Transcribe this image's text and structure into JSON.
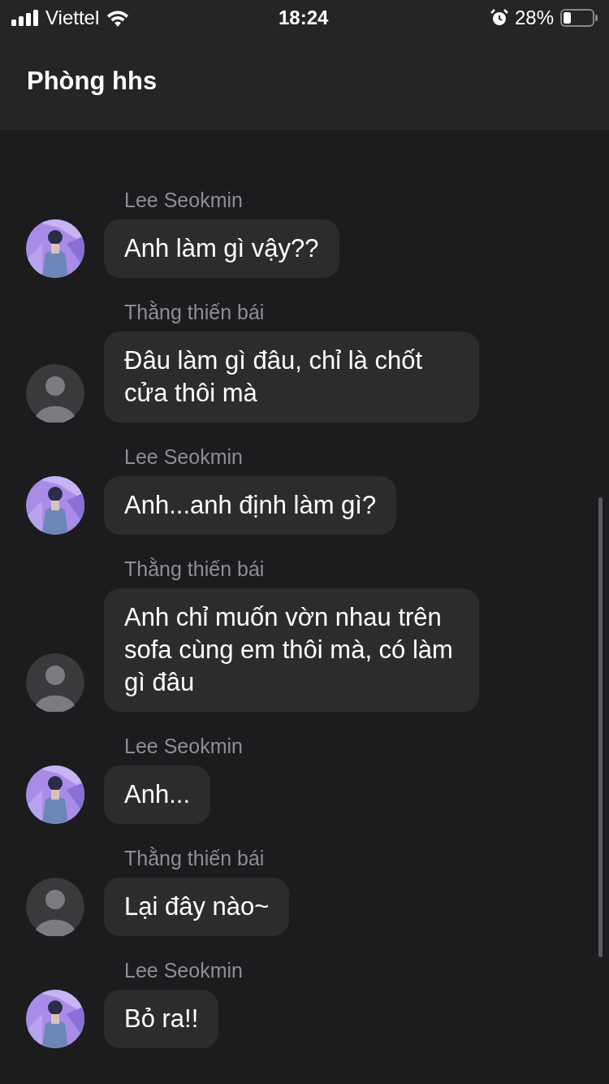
{
  "status_bar": {
    "carrier": "Viettel",
    "time": "18:24",
    "battery": "28%"
  },
  "header": {
    "title": "Phòng hhs"
  },
  "messages": [
    {
      "sender": "Lee Seokmin",
      "text": "Anh làm gì vậy??"
    },
    {
      "sender": "Thằng thiến bái",
      "kind": "default",
      "text": "Đâu làm gì đâu, chỉ là chốt cửa thôi mà"
    },
    {
      "sender": "Lee Seokmin",
      "text": "Anh...anh định làm gì?"
    },
    {
      "sender": "Thằng thiến bái",
      "kind": "default",
      "text": "Anh chỉ muốn vờn nhau trên sofa cùng em thôi mà, có làm gì đâu"
    },
    {
      "sender": "Lee Seokmin",
      "text": "Anh..."
    },
    {
      "sender": "Thằng thiến bái",
      "kind": "default",
      "text": "Lại đây nào~"
    },
    {
      "sender": "Lee Seokmin",
      "text": "Bỏ ra!!"
    }
  ]
}
